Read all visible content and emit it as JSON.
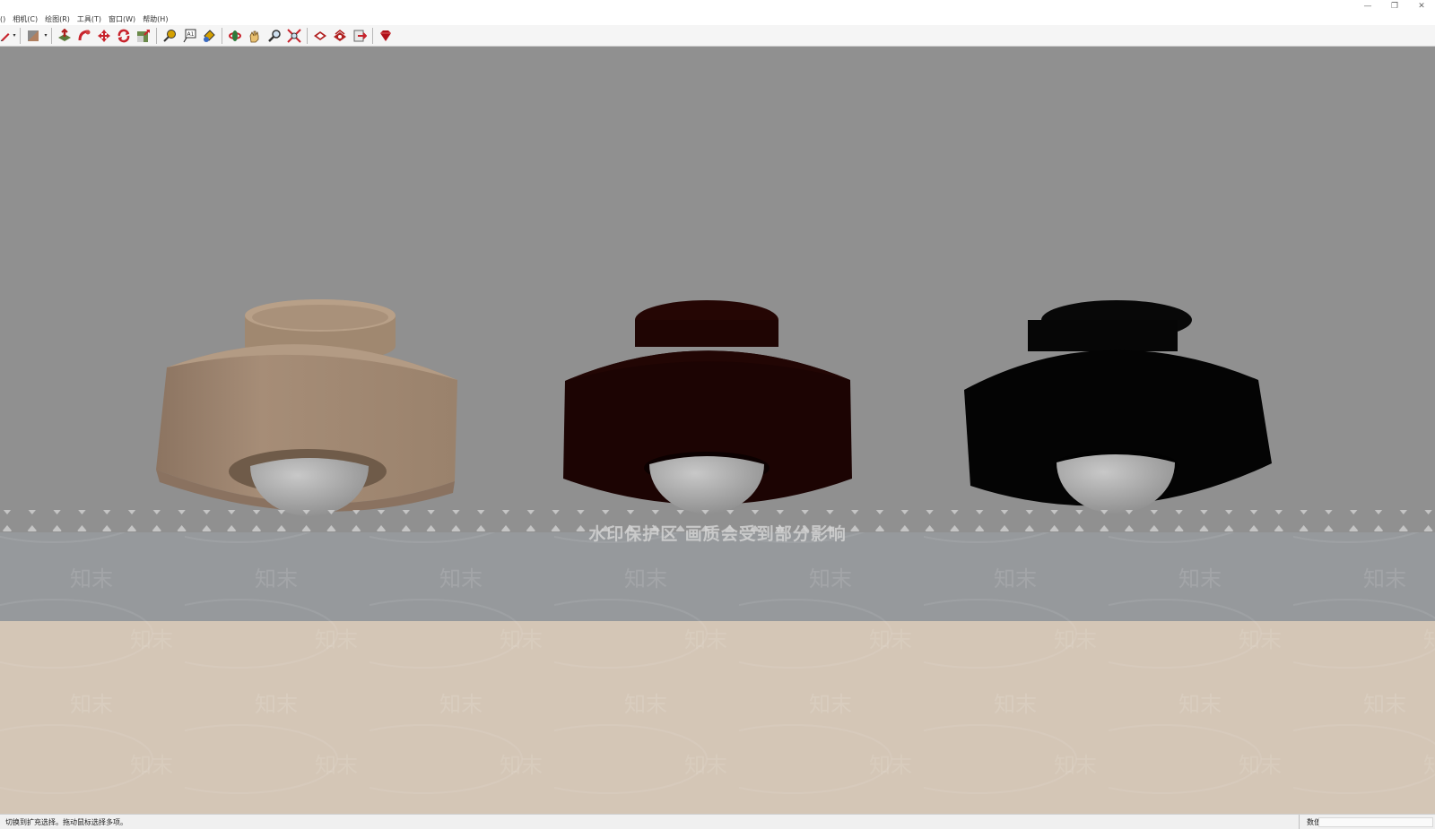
{
  "window": {
    "minimize_glyph": "—",
    "maximize_glyph": "❐",
    "close_glyph": "✕"
  },
  "menu": {
    "items": [
      "()",
      "相机(C)",
      "绘图(R)",
      "工具(T)",
      "窗口(W)",
      "帮助(H)"
    ]
  },
  "toolbar": {
    "tools": [
      {
        "name": "pencil-line-icon",
        "color": "#c8232c"
      },
      {
        "name": "material-paint-icon",
        "color": "#7a7a7a"
      },
      {
        "name": "pushpull-icon",
        "color": "#b02020"
      },
      {
        "name": "followme-icon",
        "color": "#c8232c"
      },
      {
        "name": "move-icon",
        "color": "#c8232c"
      },
      {
        "name": "rotate-icon",
        "color": "#c8232c"
      },
      {
        "name": "scale-icon",
        "color": "#c8232c"
      },
      {
        "name": "tape-measure-icon",
        "color": "#d4a000"
      },
      {
        "name": "text-icon",
        "color": "#333333"
      },
      {
        "name": "paint-bucket-icon",
        "color": "#d4a000"
      },
      {
        "name": "orbit-icon",
        "color": "#c8232c"
      },
      {
        "name": "pan-icon",
        "color": "#d4a000"
      },
      {
        "name": "zoom-icon",
        "color": "#333333"
      },
      {
        "name": "zoom-extents-icon",
        "color": "#c8232c"
      },
      {
        "name": "warehouse-icon",
        "color": "#b02020"
      },
      {
        "name": "extension-warehouse-icon",
        "color": "#b02020"
      },
      {
        "name": "send-to-layout-icon",
        "color": "#c8232c"
      },
      {
        "name": "ruby-console-icon",
        "color": "#b0101a"
      }
    ]
  },
  "scene": {
    "background": "#909090",
    "lamps": [
      {
        "name": "lamp-tan",
        "body_color": "#a28a73",
        "top_color": "#ad937a",
        "shade_color": "#8e7762"
      },
      {
        "name": "lamp-dark-red",
        "body_color": "#1c0403",
        "top_color": "#220604",
        "shade_color": "#140201"
      },
      {
        "name": "lamp-black",
        "body_color": "#040404",
        "top_color": "#080808",
        "shade_color": "#020202"
      }
    ],
    "bulb_color": "#a8a8a8",
    "floor_color": "#d4c6b6"
  },
  "watermark": {
    "band_text": "水印保护区   画质会受到部分影响",
    "tile_text": "知末"
  },
  "status": {
    "message": "切换到扩充选择。拖动鼠标选择多项。",
    "measurements_label": "数值",
    "measurements_value": ""
  }
}
